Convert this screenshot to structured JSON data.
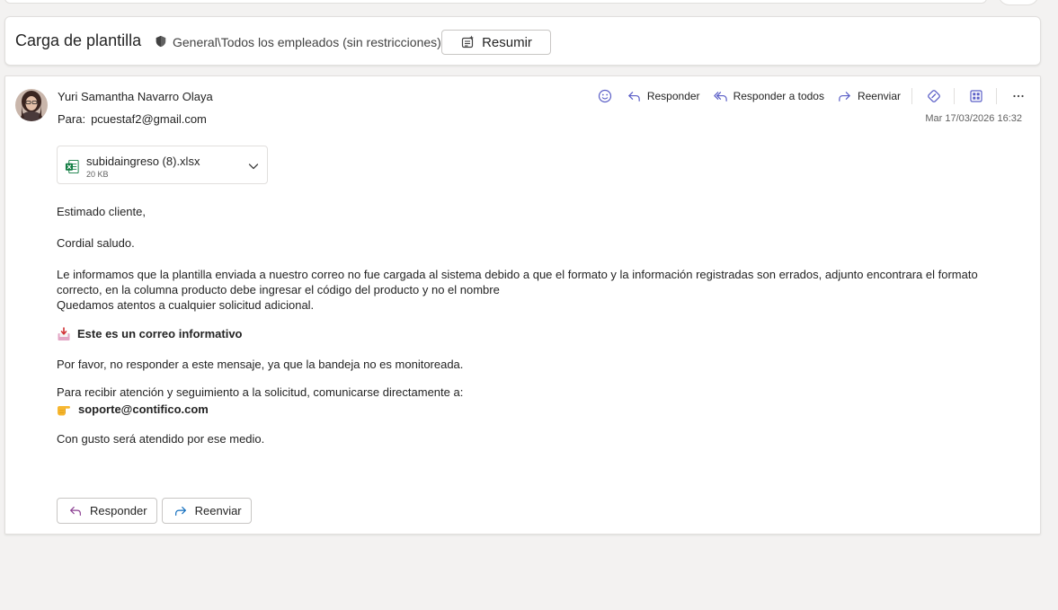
{
  "subject": {
    "title": "Carga de plantilla",
    "sensitivity": "General\\Todos los empleados (sin restricciones)",
    "summary_label": "Resumir"
  },
  "message": {
    "sender": "Yuri Samantha Navarro Olaya",
    "to_label": "Para:",
    "to_address": "pcuestaf2@gmail.com",
    "date": "Mar 17/03/2026 16:32",
    "actions": {
      "reply": "Responder",
      "reply_all": "Responder a todos",
      "forward": "Reenviar"
    },
    "attachment": {
      "name": "subidaingreso (8).xlsx",
      "size": "20 KB"
    },
    "body": {
      "greeting": "Estimado cliente,",
      "salutation": "Cordial saludo.",
      "paragraph1": "Le informamos que la plantilla enviada a nuestro correo no fue cargada al sistema debido a que el formato y la información registradas son errados, adjunto encontrara el formato correcto, en la columna producto debe ingresar el código del producto y no el nombre",
      "paragraph1b": "Quedamos atentos a cualquier solicitud adicional.",
      "notice": "Este es un correo informativo",
      "no_reply": "Por favor, no responder a este mensaje, ya que la bandeja no es monitoreada.",
      "support_intro": "Para recibir atención y seguimiento a la solicitud, comunicarse directamente a:",
      "support_email": "soporte@contifico.com",
      "closing": "Con gusto será atendido por ese medio."
    },
    "bottom_buttons": {
      "reply": "Responder",
      "forward": "Reenviar"
    }
  },
  "icons": {
    "shield": "shield-icon",
    "summary": "summary-sparkle-icon",
    "emoji": "emoji-icon",
    "reply": "reply-icon",
    "reply_all": "reply-all-icon",
    "forward": "forward-icon",
    "loop": "loop-icon",
    "apps": "apps-icon",
    "more": "more-icon",
    "excel": "excel-file-icon",
    "chevron": "chevron-down-icon",
    "inbox": "inbox-tray-icon",
    "pointing": "pointing-hand-icon"
  },
  "colors": {
    "accent": "#5b5fc7",
    "excel_green": "#107c41",
    "background": "#f3f2f1"
  }
}
